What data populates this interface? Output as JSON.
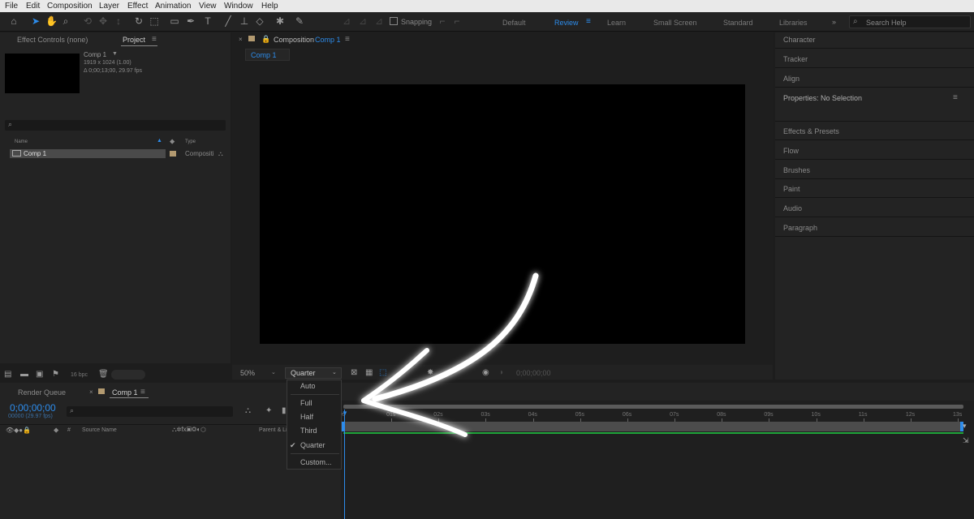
{
  "menubar": [
    "File",
    "Edit",
    "Composition",
    "Layer",
    "Effect",
    "Animation",
    "View",
    "Window",
    "Help"
  ],
  "toolbar": {
    "snapping_label": "Snapping",
    "workspaces": [
      "Default",
      "Review",
      "Learn",
      "Small Screen",
      "Standard",
      "Libraries"
    ],
    "active_workspace": "Review",
    "search_placeholder": "Search Help"
  },
  "project_panel": {
    "tab_effect_controls": "Effect Controls (none)",
    "tab_project": "Project",
    "comp_name": "Comp 1",
    "comp_dimensions": "1919 x 1024 (1.00)",
    "comp_duration": "Δ 0;00;13;00, 29.97 fps",
    "col_name": "Name",
    "col_type": "Type",
    "item_name": "Comp 1",
    "item_type": "Compositi",
    "bpc": "16 bpc"
  },
  "composition_panel": {
    "tab_prefix": "Composition",
    "tab_comp": "Comp 1",
    "breadcrumb": "Comp 1",
    "zoom": "50%",
    "resolution": "Quarter",
    "timecode": "0;00;00;00"
  },
  "resolution_menu": {
    "items": [
      "Auto",
      "Full",
      "Half",
      "Third",
      "Quarter",
      "Custom..."
    ],
    "selected": "Quarter"
  },
  "right_panel": {
    "items": [
      "Character",
      "Tracker",
      "Align",
      "Properties: No Selection",
      "Effects & Presets",
      "Flow",
      "Brushes",
      "Paint",
      "Audio",
      "Paragraph"
    ]
  },
  "timeline": {
    "tab_render_queue": "Render Queue",
    "tab_comp": "Comp 1",
    "timecode": "0;00;00;00",
    "frame_info": "00000 (29.97 fps)",
    "col_hash": "#",
    "col_source_name": "Source Name",
    "col_parent": "Parent & Li",
    "ruler_ticks": [
      "0s",
      "01s",
      "02s",
      "03s",
      "04s",
      "05s",
      "06s",
      "07s",
      "08s",
      "09s",
      "10s",
      "11s",
      "12s",
      "13s"
    ]
  },
  "colors": {
    "accent": "#2d8ceb",
    "panel_bg": "#232323",
    "app_bg": "#1d1d1d",
    "comp_label": "#b39a70",
    "work_area": "#1fa53a",
    "arrow": "#ffffff"
  }
}
